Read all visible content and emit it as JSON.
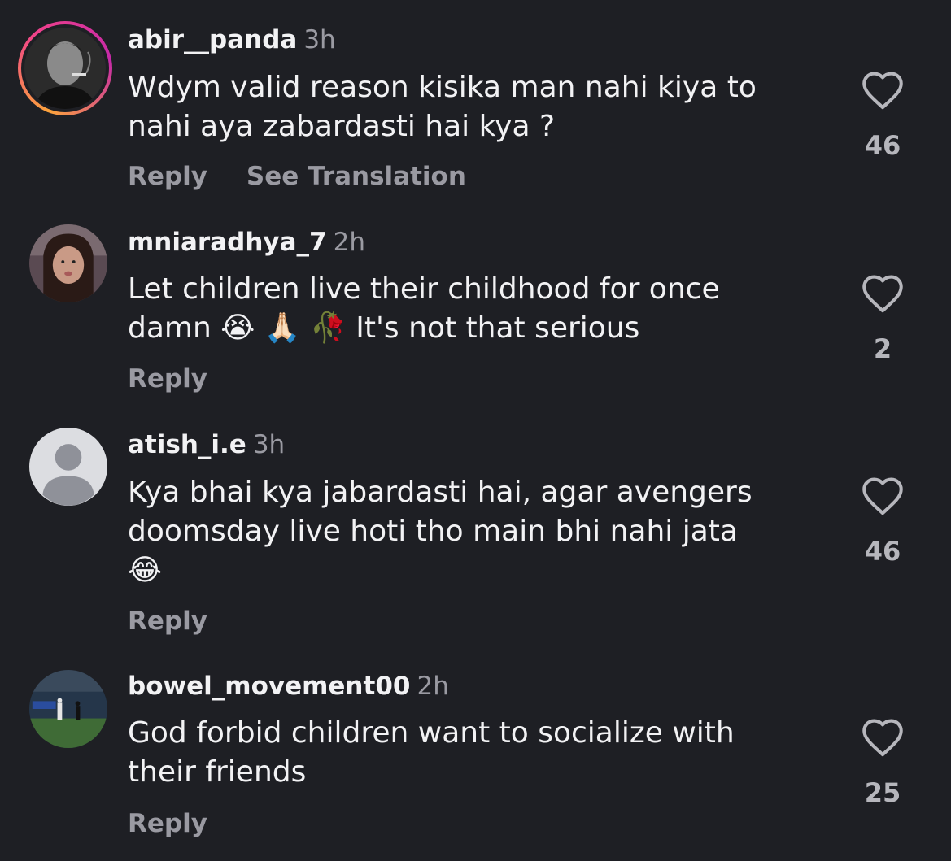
{
  "comments": [
    {
      "username": "abir__panda",
      "time": "3h",
      "text": "Wdym valid reason kisika man nahi kiya to\nnahi aya zabardasti hai kya ?",
      "reply_label": "Reply",
      "translate_label": "See Translation",
      "likes": "46",
      "avatar": "bw-portrait-smoking",
      "story_ring": true
    },
    {
      "username": "mniaradhya_7",
      "time": "2h",
      "text": "Let children live their childhood for once\ndamn 😭 🙏🏻 🥀 It's not that serious",
      "reply_label": "Reply",
      "likes": "2",
      "avatar": "selfie-girl"
    },
    {
      "username": "atish_i.e",
      "time": "3h",
      "text": "Kya bhai kya jabardasti hai, agar avengers\ndoomsday live hoti tho main bhi nahi jata\n😂",
      "reply_label": "Reply",
      "likes": "46",
      "avatar": "default-person"
    },
    {
      "username": "bowel_movement00",
      "time": "2h",
      "text": "God forbid children want to socialize with\ntheir friends",
      "reply_label": "Reply",
      "likes": "25",
      "avatar": "football-stadium"
    }
  ],
  "colors": {
    "background": "#1e1f24",
    "text_primary": "#f2f2f4",
    "text_secondary": "#9a9aa2",
    "story_ring_gradient": [
      "#fca33c",
      "#f0418b",
      "#c629a8"
    ]
  }
}
